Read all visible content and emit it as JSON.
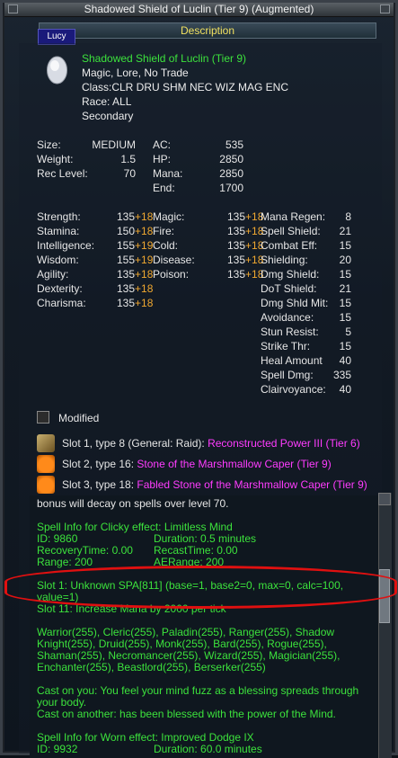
{
  "window": {
    "title": "Shadowed Shield of Luclin (Tier 9) (Augmented)",
    "tab": "Description",
    "tag": "Lucy"
  },
  "item": {
    "name": "Shadowed Shield of Luclin (Tier 9)",
    "flags": "Magic, Lore, No Trade",
    "class": "Class:CLR DRU SHM NEC WIZ MAG ENC",
    "race": "Race:  ALL",
    "slot": "Secondary"
  },
  "basic": {
    "size_label": "Size:",
    "size_value": "MEDIUM",
    "weight_label": "Weight:",
    "weight_value": "1.5",
    "reclevel_label": "Rec Level:",
    "reclevel_value": "70",
    "ac_label": "AC:",
    "ac_value": "535",
    "hp_label": "HP:",
    "hp_value": "2850",
    "mana_label": "Mana:",
    "mana_value": "2850",
    "end_label": "End:",
    "end_value": "1700"
  },
  "stats": {
    "str": {
      "label": "Strength:",
      "base": "135",
      "bonus": "+18"
    },
    "sta": {
      "label": "Stamina:",
      "base": "150",
      "bonus": "+18"
    },
    "int": {
      "label": "Intelligence:",
      "base": "155",
      "bonus": "+19"
    },
    "wis": {
      "label": "Wisdom:",
      "base": "155",
      "bonus": "+19"
    },
    "agi": {
      "label": "Agility:",
      "base": "135",
      "bonus": "+18"
    },
    "dex": {
      "label": "Dexterity:",
      "base": "135",
      "bonus": "+18"
    },
    "cha": {
      "label": "Charisma:",
      "base": "135",
      "bonus": "+18"
    }
  },
  "resists": {
    "magic": {
      "label": "Magic:",
      "base": "135",
      "bonus": "+18"
    },
    "fire": {
      "label": "Fire:",
      "base": "135",
      "bonus": "+18"
    },
    "cold": {
      "label": "Cold:",
      "base": "135",
      "bonus": "+18"
    },
    "disease": {
      "label": "Disease:",
      "base": "135",
      "bonus": "+18"
    },
    "poison": {
      "label": "Poison:",
      "base": "135",
      "bonus": "+18"
    }
  },
  "mods": {
    "mana_regen": {
      "label": "Mana Regen:",
      "value": "8"
    },
    "spell_shield": {
      "label": "Spell Shield:",
      "value": "21"
    },
    "combat_eff": {
      "label": "Combat Eff:",
      "value": "15"
    },
    "shielding": {
      "label": "Shielding:",
      "value": "20"
    },
    "dmg_shield": {
      "label": "Dmg Shield:",
      "value": "15"
    },
    "dot_shield": {
      "label": "DoT Shield:",
      "value": "21"
    },
    "dmg_shld_mit": {
      "label": "Dmg Shld Mit:",
      "value": "15"
    },
    "avoidance": {
      "label": "Avoidance:",
      "value": "15"
    },
    "stun_resist": {
      "label": "Stun Resist:",
      "value": "5"
    },
    "strike_thr": {
      "label": "Strike Thr:",
      "value": "15"
    },
    "heal_amount": {
      "label": "Heal Amount",
      "value": "40"
    },
    "spell_dmg": {
      "label": "Spell Dmg:",
      "value": "335"
    },
    "clairvoyance": {
      "label": "Clairvoyance:",
      "value": "40"
    }
  },
  "modified_label": "Modified",
  "slots": [
    {
      "prefix": "Slot 1, type 8 (General: Raid):",
      "aug": "Reconstructed Power III (Tier 6)",
      "icon": "gem-icon"
    },
    {
      "prefix": "Slot 2, type 16:",
      "aug": "Stone of the Marshmallow Caper (Tier 9)",
      "icon": "pumpkin-icon"
    },
    {
      "prefix": "Slot 3, type 18:",
      "aug": "Fabled Stone of the Marshmallow Caper (Tier 9)",
      "icon": "pumpkin-icon"
    }
  ],
  "spell_text": {
    "bonus_line": "bonus will decay on spells over level 70.",
    "clicky_header": "Spell Info for Clicky effect: Limitless Mind",
    "id": "ID: 9860",
    "duration": "Duration: 0.5 minutes",
    "recovery": "RecoveryTime: 0.00",
    "recast": "RecastTime: 0.00",
    "range": "Range: 200",
    "aerange": "AERange: 200",
    "slot1": "Slot 1: Unknown SPA[811] (base=1, base2=0, max=0, calc=100,\nvalue=1)",
    "slot11": "Slot 11: Increase Mana by 2000 per tick",
    "classes": "Warrior(255), Cleric(255), Paladin(255), Ranger(255), Shadow\nKnight(255), Druid(255), Monk(255), Bard(255), Rogue(255),\nShaman(255), Necromancer(255), Wizard(255), Magician(255),\nEnchanter(255), Beastlord(255), Berserker(255)",
    "cast_on_you": "Cast on you: You feel your mind fuzz as a blessing spreads through\nyour body.",
    "cast_on_other": "Cast on another: has been blessed with the power of the Mind.",
    "worn_header": "Spell Info for Worn effect: Improved Dodge IX",
    "worn_id": "ID: 9932",
    "worn_duration": "Duration: 60.0 minutes"
  }
}
